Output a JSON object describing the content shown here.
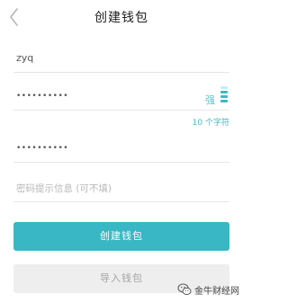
{
  "header": {
    "title": "创建钱包"
  },
  "form": {
    "wallet_name": "zyq",
    "password": "••••••••••",
    "strength_label": "强",
    "length_hint": "10 个字符",
    "confirm_password": "••••••••••",
    "hint_placeholder": "密码提示信息 (可不填)"
  },
  "buttons": {
    "create": "创建钱包",
    "import": "导入钱包"
  },
  "watermark": {
    "text": "金牛财经网"
  },
  "colors": {
    "accent": "#3ab7c5",
    "secondary_button": "#eeeeee"
  },
  "icons": {
    "back": "back-chevron-icon",
    "watermark": "wechat-logo-icon"
  }
}
